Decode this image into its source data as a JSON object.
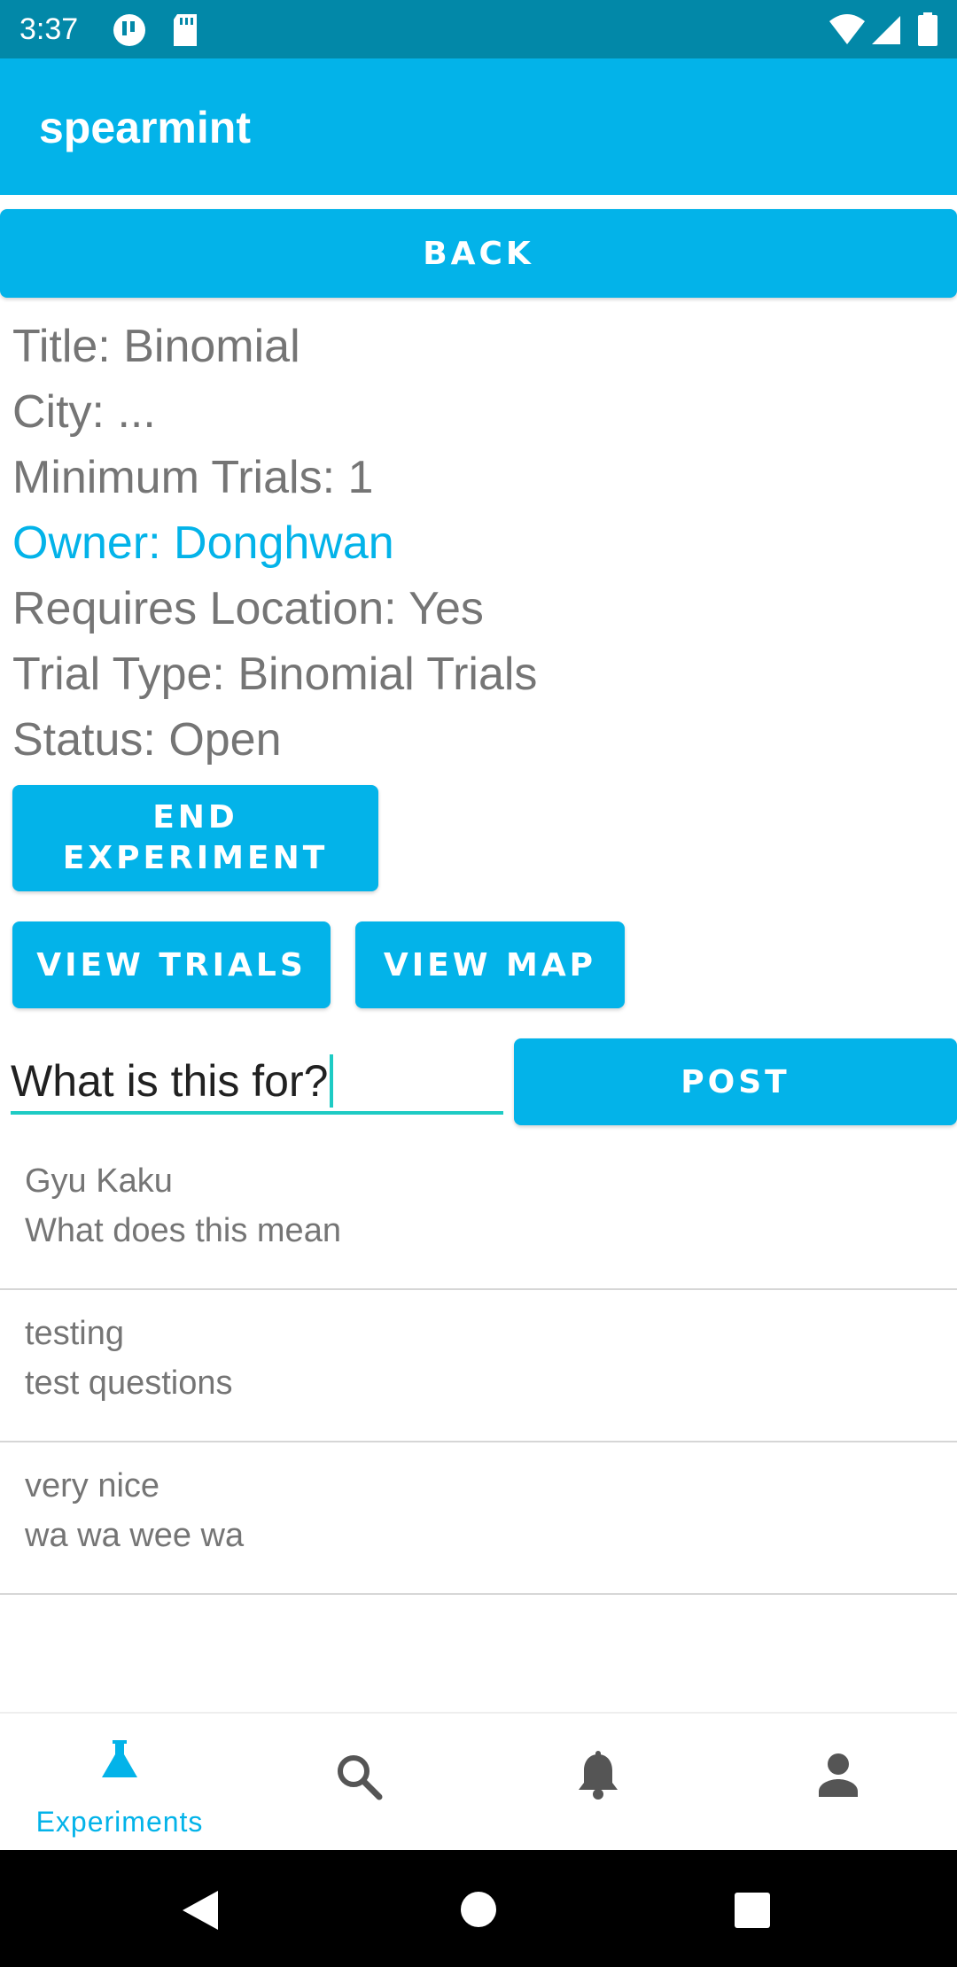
{
  "status_bar": {
    "time": "3:37"
  },
  "app_bar": {
    "title": "spearmint"
  },
  "back_button": {
    "label": "BACK"
  },
  "experiment": {
    "title_line": "Title: Binomial",
    "city_line": "City: ...",
    "min_trials_line": "Minimum Trials: 1",
    "owner_line": "Owner: Donghwan",
    "requires_location_line": "Requires Location: Yes",
    "trial_type_line": "Trial Type: Binomial Trials",
    "status_line": "Status: Open"
  },
  "actions": {
    "end_experiment_line1": "END",
    "end_experiment_line2": "EXPERIMENT",
    "view_trials": "VIEW TRIALS",
    "view_map": "VIEW MAP"
  },
  "question": {
    "value": "What is this for?",
    "post_label": "POST"
  },
  "comments": [
    {
      "user": "Gyu Kaku",
      "text": "What does this mean"
    },
    {
      "user": "testing",
      "text": "test questions"
    },
    {
      "user": "very nice",
      "text": "wa wa wee wa"
    }
  ],
  "bottom_nav": {
    "items": [
      {
        "label": "Experiments",
        "icon": "flask-icon"
      },
      {
        "label": "",
        "icon": "search-icon"
      },
      {
        "label": "",
        "icon": "bell-icon"
      },
      {
        "label": "",
        "icon": "person-icon"
      }
    ]
  },
  "colors": {
    "accent": "#03b3e9",
    "status_bar": "#0288a8",
    "text_gray": "#757575",
    "input_underline": "#1ecbc4"
  }
}
